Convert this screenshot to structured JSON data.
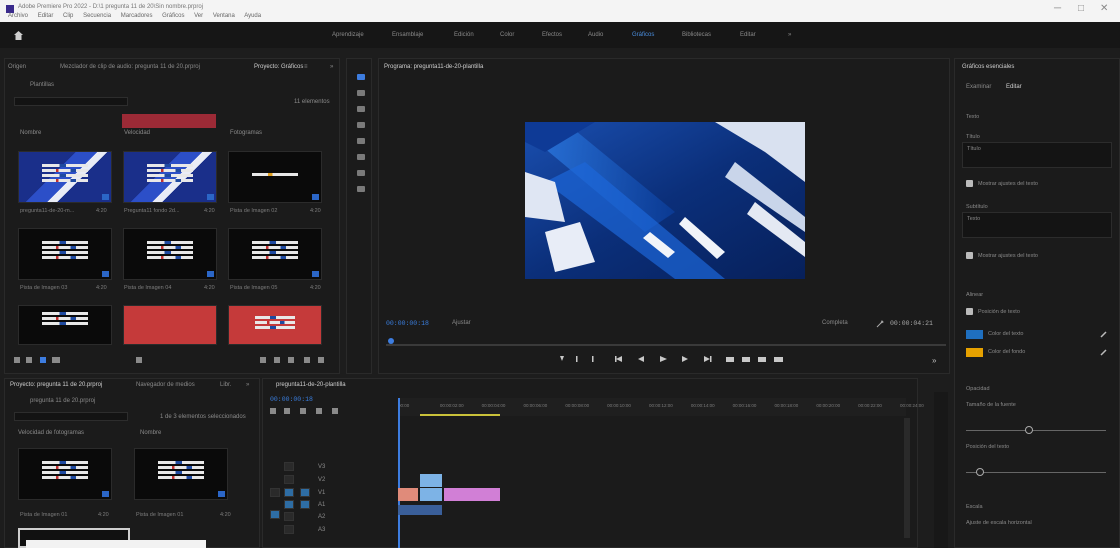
{
  "window": {
    "title": "Adobe Premiere Pro 2022 - D:\\1 pregunta 11 de 20\\Sin nombre.prproj",
    "menu": [
      "Archivo",
      "Editar",
      "Clip",
      "Secuencia",
      "Marcadores",
      "Gráficos",
      "Ver",
      "Ventana",
      "Ayuda"
    ],
    "controls": [
      "─",
      "□",
      "✕"
    ]
  },
  "workspaces": {
    "items": [
      "Aprendizaje",
      "Ensamblaje",
      "Edición",
      "Color",
      "Efectos",
      "Audio",
      "Gráficos",
      "Bibliotecas",
      "Editar"
    ],
    "active": "Gráficos",
    "more": "»"
  },
  "source_panel": {
    "tabs": [
      "Origen",
      "Mezclador de clip de audio: pregunta 11 de 20.prproj",
      "Proyecto: Gráficos",
      "≡",
      "»"
    ],
    "breadcrumb": "Plantillas",
    "search_placeholder": "",
    "count": "11 elementos",
    "columns": [
      "Nombre",
      "Velocidad",
      "Fotogramas"
    ],
    "items": [
      {
        "label": "pregunta11-de-20-m...",
        "dur": "4:20"
      },
      {
        "label": "Pregunta11 fondo 2d...",
        "dur": "4:20"
      },
      {
        "label": "Pista de Imagen 02",
        "dur": "4:20"
      },
      {
        "label": "Pista de Imagen 03",
        "dur": "4:20"
      },
      {
        "label": "Pista de Imagen 04",
        "dur": "4:20"
      },
      {
        "label": "Pista de Imagen 05",
        "dur": "4:20"
      },
      {
        "label": "",
        "dur": ""
      },
      {
        "label": "",
        "dur": ""
      },
      {
        "label": "",
        "dur": ""
      }
    ]
  },
  "program_monitor": {
    "tab": "Programa: pregunta11-de-20-plantilla",
    "timecode": "00:00:00:18",
    "fit": "Ajustar",
    "quality": "Completa",
    "duration": "00:00:04:21"
  },
  "project_panel": {
    "tabs": [
      "Proyecto: pregunta 11 de 20.prproj",
      "Navegador de medios",
      "Libr.",
      "»"
    ],
    "breadcrumb": "pregunta 11 de 20.prproj",
    "count": "1 de 3 elementos seleccionados",
    "columns": [
      "Velocidad de fotogramas",
      "Nombre"
    ],
    "items": [
      {
        "label": "Pista de Imagen 01",
        "dur": "4:20"
      },
      {
        "label": "Pista de Imagen 01",
        "dur": "4:20"
      }
    ]
  },
  "timeline": {
    "tab": "pregunta11-de-20-plantilla",
    "timecode": "00:00:00:18",
    "ticks": [
      "00:00",
      "00:00:02:00",
      "00:00:04:00",
      "00:00:06:00",
      "00:00:08:00",
      "00:00:10:00",
      "00:00:12:00",
      "00:00:14:00",
      "00:00:16:00",
      "00:00:18:00",
      "00:00:20:00",
      "00:00:22:00",
      "00:00:24:00"
    ],
    "tracks": [
      "V3",
      "V2",
      "V1",
      "A1",
      "A2",
      "A3"
    ]
  },
  "effect_controls": {
    "tab": "Gráficos esenciales",
    "subtabs": [
      "Examinar",
      "Editar"
    ],
    "fields": [
      {
        "label": "Texto",
        "value": ""
      },
      {
        "label": "Título",
        "value": "Título"
      },
      {
        "label": "Subtítulo",
        "value": "Texto"
      }
    ],
    "checks": [
      "Mostrar ajustes del texto",
      "Mostrar ajustes del texto"
    ],
    "align_label": "Alinear",
    "sub_check": "Posición de texto",
    "colors": [
      {
        "label": "Color del texto",
        "value": "#1f6fbf"
      },
      {
        "label": "Color del fondo",
        "value": "#e6a100"
      }
    ],
    "group1": "Opacidad",
    "sliders": [
      {
        "label": "Tamaño de la fuente",
        "value": 0.45
      },
      {
        "label": "Posición del texto",
        "value": 0.1
      }
    ],
    "group2": "Escala",
    "more_label": "Ajuste de escala horizontal"
  },
  "colors": {
    "accent": "#3d7de0",
    "clip_salmon": "#e08b7a",
    "clip_blue": "#7db3e6",
    "clip_pink": "#d17fd6",
    "audio_clip": "#3a5f9a"
  }
}
